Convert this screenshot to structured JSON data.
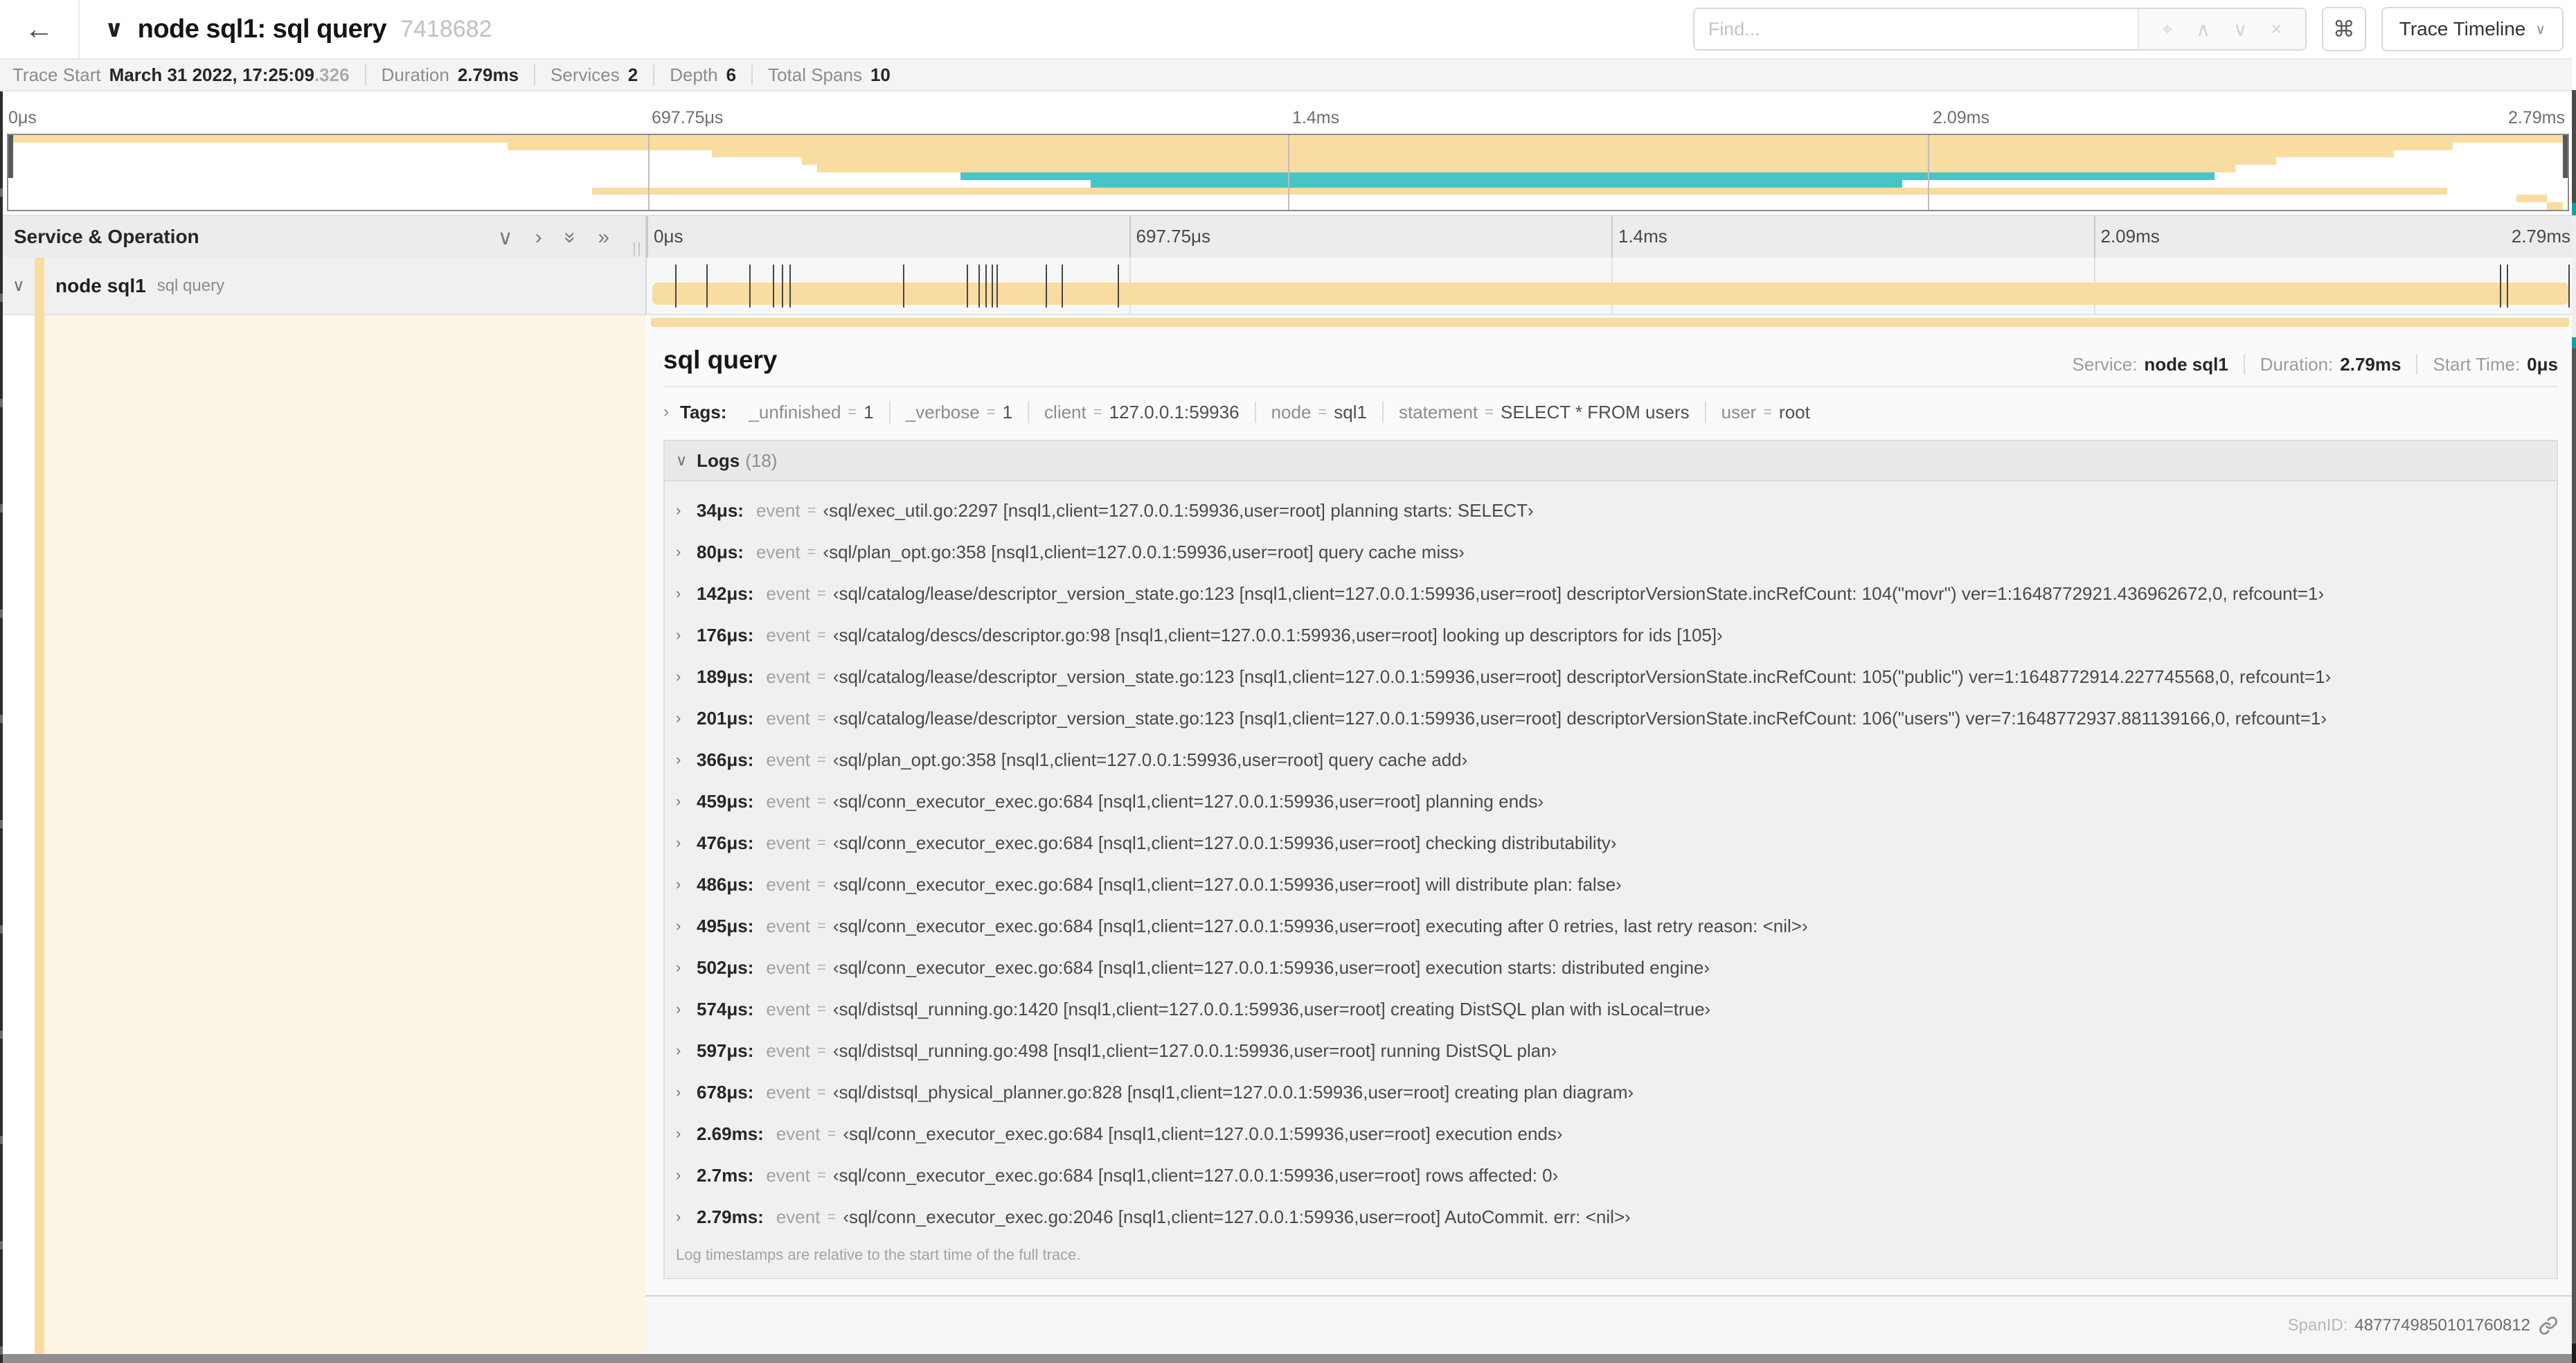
{
  "topbar": {
    "back_icon": "←",
    "collapse_icon": "∨",
    "title": "node sql1: sql query",
    "trace_id": "7418682",
    "find_placeholder": "Find...",
    "find_tools": [
      "⌖",
      "∧",
      "∨",
      "×"
    ],
    "kbd_icon": "⌘",
    "view_button_label": "Trace Timeline",
    "view_button_caret": "∨"
  },
  "summary": {
    "items": [
      {
        "label": "Trace Start",
        "value": "March 31 2022, 17:25:09",
        "suffix": ".326"
      },
      {
        "label": "Duration",
        "value": "2.79ms",
        "suffix": ""
      },
      {
        "label": "Services",
        "value": "2",
        "suffix": ""
      },
      {
        "label": "Depth",
        "value": "6",
        "suffix": ""
      },
      {
        "label": "Total Spans",
        "value": "10",
        "suffix": ""
      }
    ]
  },
  "ruler": {
    "ticks": [
      {
        "label": "0μs",
        "pct": 0
      },
      {
        "label": "697.75μs",
        "pct": 25
      },
      {
        "label": "1.4ms",
        "pct": 50
      },
      {
        "label": "2.09ms",
        "pct": 75
      },
      {
        "label": "2.79ms",
        "pct": 100
      }
    ]
  },
  "minimap": {
    "spans": [
      {
        "color": "#F8DCA1",
        "start_pct": 0,
        "end_pct": 100
      },
      {
        "color": "#F8DCA1",
        "start_pct": 19.5,
        "end_pct": 95.5
      },
      {
        "color": "#F8DCA1",
        "start_pct": 27.5,
        "end_pct": 93.2
      },
      {
        "color": "#F8DCA1",
        "start_pct": 31,
        "end_pct": 88.6
      },
      {
        "color": "#F8DCA1",
        "start_pct": 31.6,
        "end_pct": 87
      },
      {
        "color": "#46C5C8",
        "start_pct": 37.2,
        "end_pct": 86.2
      },
      {
        "color": "#46C5C8",
        "start_pct": 42.3,
        "end_pct": 74
      },
      {
        "color": "#F8DCA1",
        "start_pct": 22.8,
        "end_pct": 95.3
      },
      {
        "color": "#F8DCA1",
        "start_pct": 98,
        "end_pct": 99.2
      },
      {
        "color": "#F8DCA1",
        "start_pct": 99.2,
        "end_pct": 99.8
      }
    ]
  },
  "grid": {
    "header_left_label": "Service & Operation",
    "collapse_icons": [
      "∨",
      "›",
      "»",
      "»"
    ]
  },
  "span_row": {
    "chevron": "∨",
    "service": "node sql1",
    "operation": "sql query",
    "bar_color": "#F8DCA1"
  },
  "detail": {
    "title": "sql query",
    "stats": [
      {
        "label": "Service:",
        "value": "node sql1"
      },
      {
        "label": "Duration:",
        "value": "2.79ms"
      },
      {
        "label": "Start Time:",
        "value": "0μs"
      }
    ],
    "tags": {
      "chevron": "›",
      "label": "Tags:",
      "eq": "=",
      "items": [
        {
          "key": "_unfinished",
          "value": "1"
        },
        {
          "key": "_verbose",
          "value": "1"
        },
        {
          "key": "client",
          "value": "127.0.0.1:59936"
        },
        {
          "key": "node",
          "value": "sql1"
        },
        {
          "key": "statement",
          "value": "SELECT * FROM users"
        },
        {
          "key": "user",
          "value": "root"
        }
      ]
    },
    "logs": {
      "chevron": "∨",
      "label": "Logs",
      "count": "(18)",
      "row_chevron": "›",
      "event_key": "event",
      "eq": "=",
      "total_us": 2790,
      "items": [
        {
          "time": "34μs:",
          "t_us": 34,
          "event": "‹sql/exec_util.go:2297 [nsql1,client=127.0.0.1:59936,user=root] planning starts: SELECT›"
        },
        {
          "time": "80μs:",
          "t_us": 80,
          "event": "‹sql/plan_opt.go:358 [nsql1,client=127.0.0.1:59936,user=root] query cache miss›"
        },
        {
          "time": "142μs:",
          "t_us": 142,
          "event": "‹sql/catalog/lease/descriptor_version_state.go:123 [nsql1,client=127.0.0.1:59936,user=root] descriptorVersionState.incRefCount: 104(\"movr\") ver=1:1648772921.436962672,0, refcount=1›"
        },
        {
          "time": "176μs:",
          "t_us": 176,
          "event": "‹sql/catalog/descs/descriptor.go:98 [nsql1,client=127.0.0.1:59936,user=root] looking up descriptors for ids [105]›"
        },
        {
          "time": "189μs:",
          "t_us": 189,
          "event": "‹sql/catalog/lease/descriptor_version_state.go:123 [nsql1,client=127.0.0.1:59936,user=root] descriptorVersionState.incRefCount: 105(\"public\") ver=1:1648772914.227745568,0, refcount=1›"
        },
        {
          "time": "201μs:",
          "t_us": 201,
          "event": "‹sql/catalog/lease/descriptor_version_state.go:123 [nsql1,client=127.0.0.1:59936,user=root] descriptorVersionState.incRefCount: 106(\"users\") ver=7:1648772937.881139166,0, refcount=1›"
        },
        {
          "time": "366μs:",
          "t_us": 366,
          "event": "‹sql/plan_opt.go:358 [nsql1,client=127.0.0.1:59936,user=root] query cache add›"
        },
        {
          "time": "459μs:",
          "t_us": 459,
          "event": "‹sql/conn_executor_exec.go:684 [nsql1,client=127.0.0.1:59936,user=root] planning ends›"
        },
        {
          "time": "476μs:",
          "t_us": 476,
          "event": "‹sql/conn_executor_exec.go:684 [nsql1,client=127.0.0.1:59936,user=root] checking distributability›"
        },
        {
          "time": "486μs:",
          "t_us": 486,
          "event": "‹sql/conn_executor_exec.go:684 [nsql1,client=127.0.0.1:59936,user=root] will distribute plan: false›"
        },
        {
          "time": "495μs:",
          "t_us": 495,
          "event": "‹sql/conn_executor_exec.go:684 [nsql1,client=127.0.0.1:59936,user=root] executing after 0 retries, last retry reason: <nil>›"
        },
        {
          "time": "502μs:",
          "t_us": 502,
          "event": "‹sql/conn_executor_exec.go:684 [nsql1,client=127.0.0.1:59936,user=root] execution starts: distributed engine›"
        },
        {
          "time": "574μs:",
          "t_us": 574,
          "event": "‹sql/distsql_running.go:1420 [nsql1,client=127.0.0.1:59936,user=root] creating DistSQL plan with isLocal=true›"
        },
        {
          "time": "597μs:",
          "t_us": 597,
          "event": "‹sql/distsql_running.go:498 [nsql1,client=127.0.0.1:59936,user=root] running DistSQL plan›"
        },
        {
          "time": "678μs:",
          "t_us": 678,
          "event": "‹sql/distsql_physical_planner.go:828 [nsql1,client=127.0.0.1:59936,user=root] creating plan diagram›"
        },
        {
          "time": "2.69ms:",
          "t_us": 2690,
          "event": "‹sql/conn_executor_exec.go:684 [nsql1,client=127.0.0.1:59936,user=root] execution ends›"
        },
        {
          "time": "2.7ms:",
          "t_us": 2700,
          "event": "‹sql/conn_executor_exec.go:684 [nsql1,client=127.0.0.1:59936,user=root] rows affected: 0›"
        },
        {
          "time": "2.79ms:",
          "t_us": 2790,
          "event": "‹sql/conn_executor_exec.go:2046 [nsql1,client=127.0.0.1:59936,user=root] AutoCommit. err: <nil>›"
        }
      ],
      "note": "Log timestamps are relative to the start time of the full trace."
    }
  },
  "footer": {
    "spanid_label": "SpanID:",
    "spanid": "4877749850101760812"
  },
  "colors": {
    "span_tan": "#F8DCA1",
    "span_teal": "#46C5C8"
  }
}
